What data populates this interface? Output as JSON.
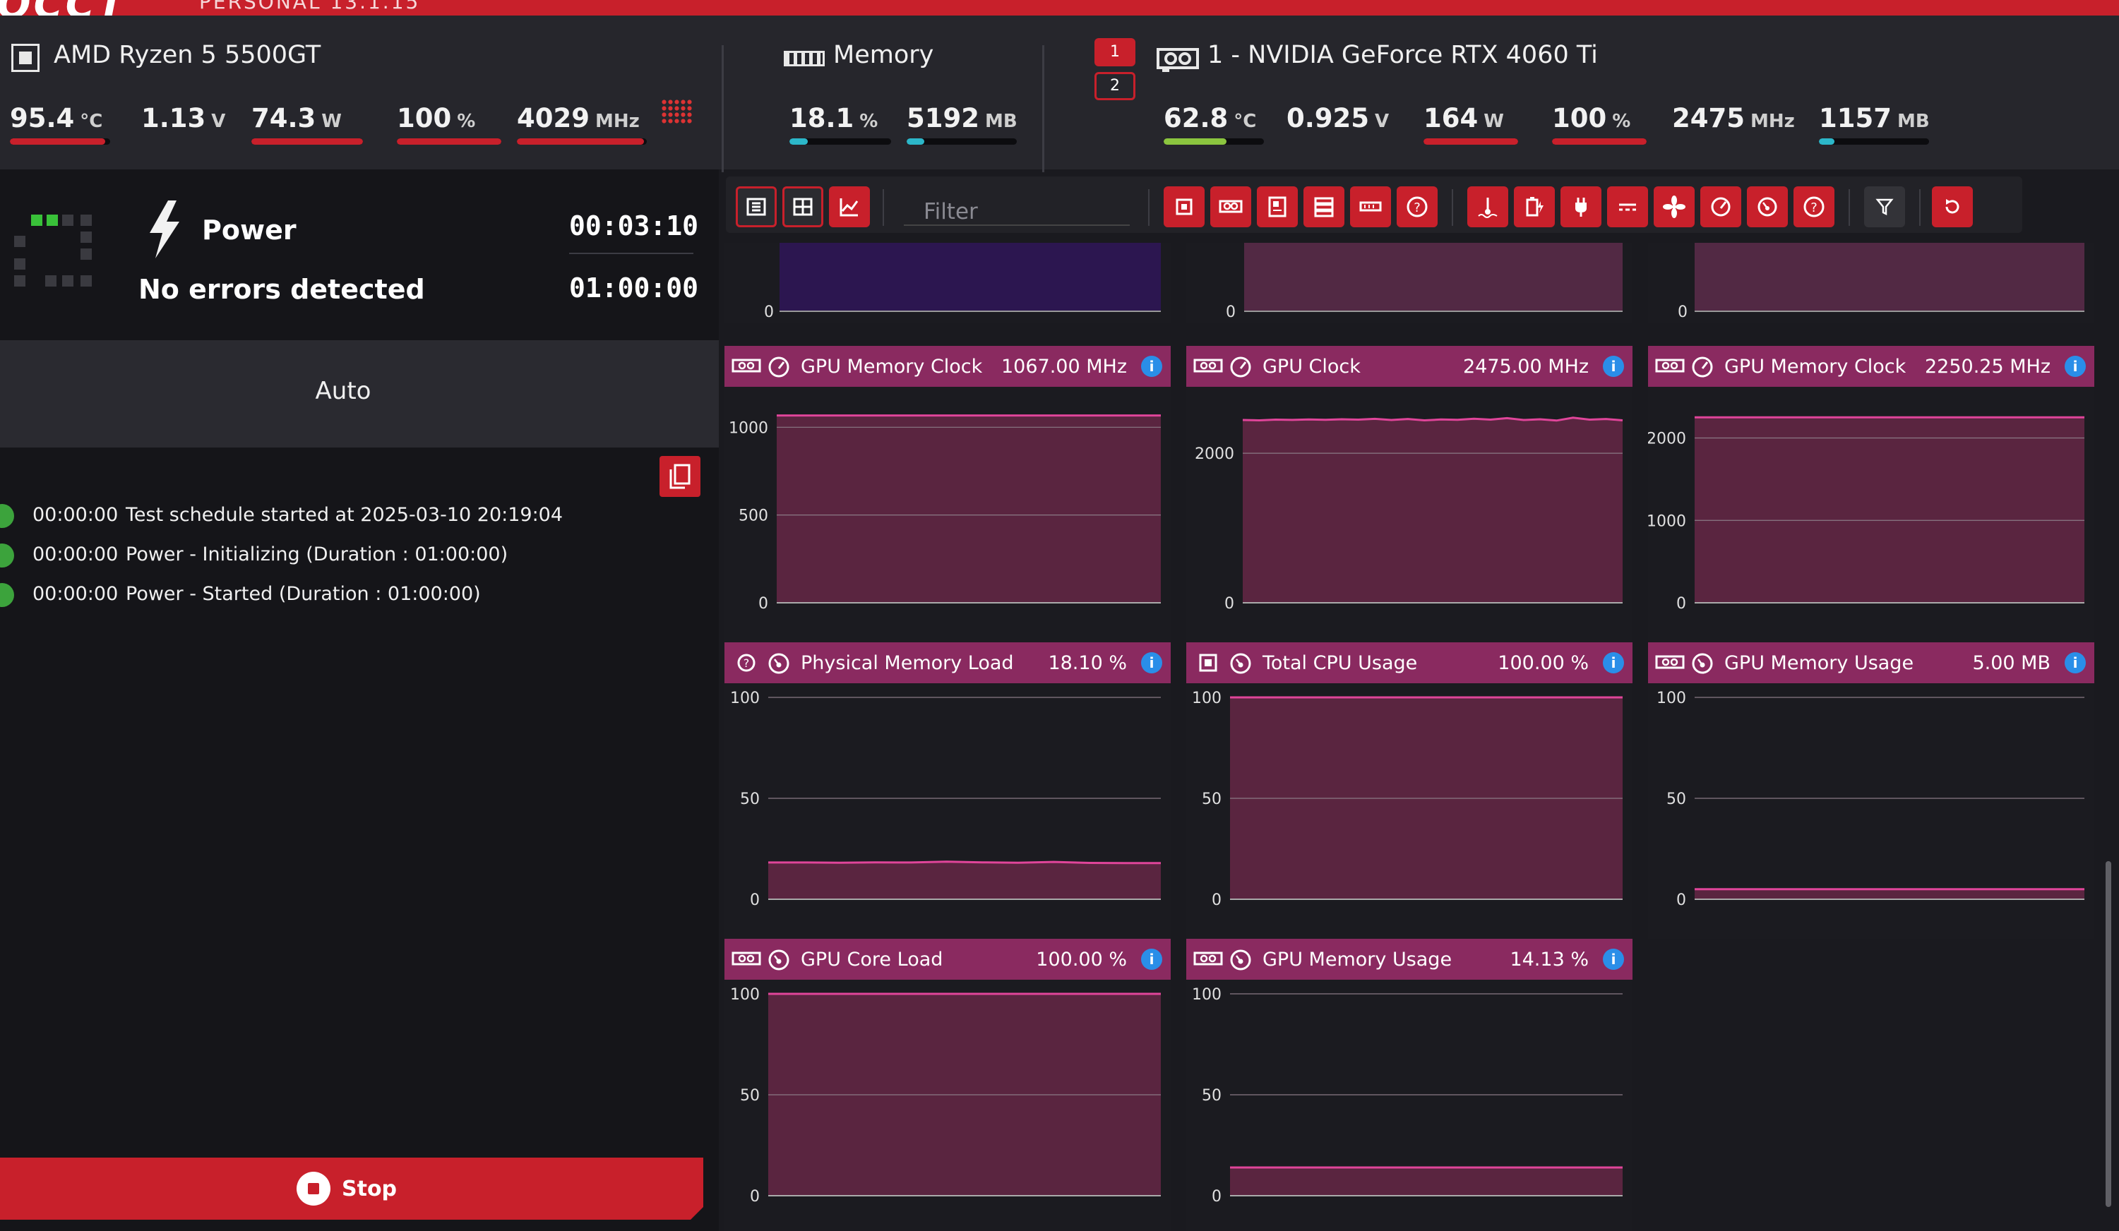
{
  "app": {
    "logo": "OCCT",
    "edition": "PERSONAL 13.1.15"
  },
  "cpu": {
    "name": "AMD Ryzen 5 5500GT",
    "metrics": [
      {
        "value": "95.4",
        "unit": "°C",
        "level": 0.95
      },
      {
        "value": "1.13",
        "unit": "V",
        "level": 0.0
      },
      {
        "value": "74.3",
        "unit": "W",
        "level": 1.0
      },
      {
        "value": "100",
        "unit": "%",
        "level": 1.0
      },
      {
        "value": "4029",
        "unit": "MHz",
        "level": 0.98
      }
    ]
  },
  "memory": {
    "name": "Memory",
    "metrics": [
      {
        "value": "18.1",
        "unit": "%",
        "level": 0.18
      },
      {
        "value": "5192",
        "unit": "MB",
        "level": 0.16
      }
    ]
  },
  "gpu": {
    "name": "1 - NVIDIA GeForce RTX 4060 Ti",
    "selector": [
      "1",
      "2"
    ],
    "metrics": [
      {
        "value": "62.8",
        "unit": "°C",
        "level": 0.63
      },
      {
        "value": "0.925",
        "unit": "V",
        "level": 0.0
      },
      {
        "value": "164",
        "unit": "W",
        "level": 1.0
      },
      {
        "value": "100",
        "unit": "%",
        "level": 1.0
      },
      {
        "value": "2475",
        "unit": "MHz",
        "level": 0.0
      },
      {
        "value": "1157",
        "unit": "MB",
        "level": 0.14
      }
    ]
  },
  "test": {
    "name": "Power",
    "status": "No errors detected",
    "elapsed": "00:03:10",
    "duration": "01:00:00",
    "mode": "Auto"
  },
  "log": [
    {
      "time": "00:00:00",
      "message": "Test schedule started at 2025-03-10 20:19:04"
    },
    {
      "time": "00:00:00",
      "message": "Power - Initializing (Duration : 01:00:00)"
    },
    {
      "time": "00:00:00",
      "message": "Power - Started (Duration : 01:00:00)"
    }
  ],
  "stop_label": "Stop",
  "filter_placeholder": "Filter",
  "colors": {
    "accent": "#c8202b",
    "panel_header": "#8a2a60",
    "series_line": "#e0459a",
    "fill": "#5a2540",
    "ok": "#3ca33c",
    "info": "#2a8ee8"
  },
  "panels": [
    {
      "title": "GPU Memory Clock",
      "value": "1067.00 MHz",
      "device_icon": "gpu-icon",
      "type_icon": "clock-gauge-icon",
      "chart_data": {
        "type": "area",
        "ylim": [
          0,
          1150
        ],
        "yticks": [
          0,
          500,
          1000
        ],
        "values": [
          1067,
          1067,
          1067,
          1067,
          1067,
          1067,
          1067,
          1067,
          1067,
          1067
        ]
      }
    },
    {
      "title": "GPU Clock",
      "value": "2475.00 MHz",
      "device_icon": "gpu-icon",
      "type_icon": "clock-gauge-icon",
      "chart_data": {
        "type": "area",
        "ylim": [
          0,
          2700
        ],
        "yticks": [
          0,
          2000
        ],
        "values": [
          2445,
          2440,
          2450,
          2446,
          2452,
          2448,
          2455,
          2450,
          2460,
          2445,
          2458,
          2440,
          2452,
          2448,
          2462,
          2450,
          2470,
          2445,
          2455,
          2438,
          2475,
          2450,
          2458,
          2440
        ]
      }
    },
    {
      "title": "GPU Memory Clock",
      "value": "2250.25 MHz",
      "device_icon": "gpu-icon",
      "type_icon": "clock-gauge-icon",
      "chart_data": {
        "type": "area",
        "ylim": [
          0,
          2450
        ],
        "yticks": [
          0,
          1000,
          2000
        ],
        "values": [
          2250,
          2250,
          2250,
          2250,
          2250,
          2250,
          2250,
          2250,
          2250,
          2250
        ]
      }
    },
    {
      "title": "Physical Memory Load",
      "value": "18.10 %",
      "device_icon": "question-icon",
      "type_icon": "load-gauge-icon",
      "chart_data": {
        "type": "area",
        "ylim": [
          0,
          100
        ],
        "yticks": [
          0,
          50,
          100
        ],
        "values": [
          18.2,
          18.2,
          18.1,
          18.3,
          18.2,
          18.6,
          18.3,
          18.1,
          18.5,
          18.0,
          17.9,
          17.9
        ]
      }
    },
    {
      "title": "Total CPU Usage",
      "value": "100.00 %",
      "device_icon": "cpu-icon",
      "type_icon": "load-gauge-icon",
      "chart_data": {
        "type": "area",
        "ylim": [
          0,
          100
        ],
        "yticks": [
          0,
          50,
          100
        ],
        "values": [
          100,
          100,
          100,
          100,
          100,
          100,
          100,
          100
        ]
      }
    },
    {
      "title": "GPU Memory Usage",
      "value": "5.00 MB",
      "device_icon": "gpu-icon",
      "type_icon": "load-gauge-icon",
      "chart_data": {
        "type": "area",
        "ylim": [
          0,
          100
        ],
        "yticks": [
          0,
          50,
          100
        ],
        "values": [
          5,
          5,
          5,
          5,
          5,
          5,
          5,
          5
        ]
      }
    },
    {
      "title": "GPU Core Load",
      "value": "100.00 %",
      "device_icon": "gpu-icon",
      "type_icon": "load-gauge-icon",
      "chart_data": {
        "type": "area",
        "ylim": [
          0,
          100
        ],
        "yticks": [
          0,
          50,
          100
        ],
        "values": [
          100,
          100,
          100,
          100,
          100,
          100,
          100,
          100
        ]
      }
    },
    {
      "title": "GPU Memory Usage",
      "value": "14.13 %",
      "device_icon": "gpu-icon",
      "type_icon": "load-gauge-icon",
      "chart_data": {
        "type": "area",
        "ylim": [
          0,
          100
        ],
        "yticks": [
          0,
          50,
          100
        ],
        "values": [
          14,
          14,
          14,
          14,
          14,
          14,
          14,
          14
        ]
      }
    }
  ]
}
